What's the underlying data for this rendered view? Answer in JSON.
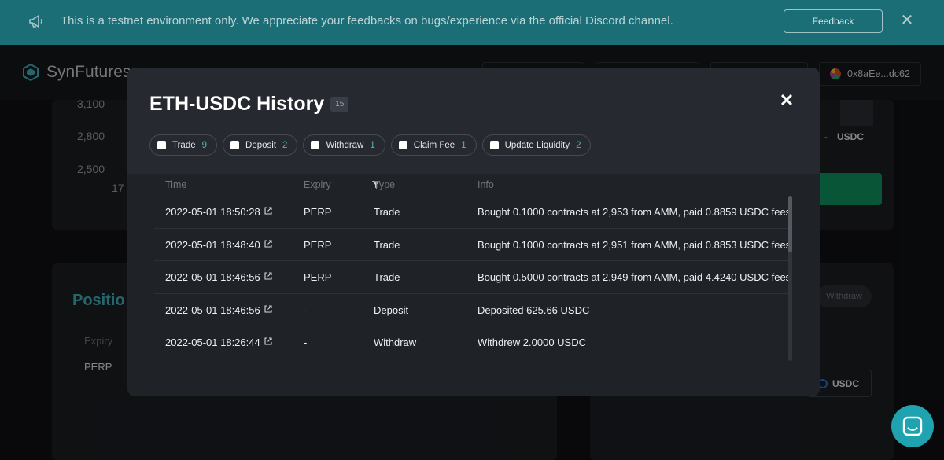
{
  "banner": {
    "message": "This is a testnet environment only. We appreciate your feedbacks on bugs/experience via the official Discord channel.",
    "feedback_label": "Feedback",
    "close_symbol": "✕",
    "icon": "megaphone-icon"
  },
  "header": {
    "brand": "SynFutures",
    "wallet_address": "0x8aEe...dc62"
  },
  "background": {
    "price_ticks": [
      "3,100",
      "2,800",
      "2,500"
    ],
    "date_tick": "17",
    "positions_title": "Positio",
    "expiry_label": "Expiry",
    "expiry_value": "PERP",
    "currency_label": "USDC",
    "currency_label_2": "USDC",
    "dash": "-",
    "withdraw_label": "Withdraw"
  },
  "modal": {
    "title": "ETH-USDC History",
    "total_count": "15",
    "close_symbol": "✕",
    "filters": [
      {
        "label": "Trade",
        "count": "9"
      },
      {
        "label": "Deposit",
        "count": "2"
      },
      {
        "label": "Withdraw",
        "count": "1"
      },
      {
        "label": "Claim Fee",
        "count": "1"
      },
      {
        "label": "Update Liquidity",
        "count": "2"
      }
    ],
    "columns": {
      "time": "Time",
      "expiry": "Expiry",
      "type": "Type",
      "info": "Info"
    },
    "rows": [
      {
        "time": "2022-05-01 18:50:28",
        "expiry": "PERP",
        "type": "Trade",
        "info": "Bought 0.1000 contracts at 2,953 from AMM, paid 0.8859 USDC fees"
      },
      {
        "time": "2022-05-01 18:48:40",
        "expiry": "PERP",
        "type": "Trade",
        "info": "Bought 0.1000 contracts at 2,951 from AMM, paid 0.8853 USDC fees"
      },
      {
        "time": "2022-05-01 18:46:56",
        "expiry": "PERP",
        "type": "Trade",
        "info": "Bought 0.5000 contracts at 2,949 from AMM, paid 4.4240 USDC fees"
      },
      {
        "time": "2022-05-01 18:46:56",
        "expiry": "-",
        "type": "Deposit",
        "info": "Deposited 625.66 USDC"
      },
      {
        "time": "2022-05-01 18:26:44",
        "expiry": "-",
        "type": "Withdraw",
        "info": "Withdrew 2.0000 USDC"
      }
    ]
  },
  "colors": {
    "banner": "#1b6e76",
    "accent": "#4fb4be",
    "modal_bg": "#262a30",
    "chat_button": "#1fa3b1"
  }
}
